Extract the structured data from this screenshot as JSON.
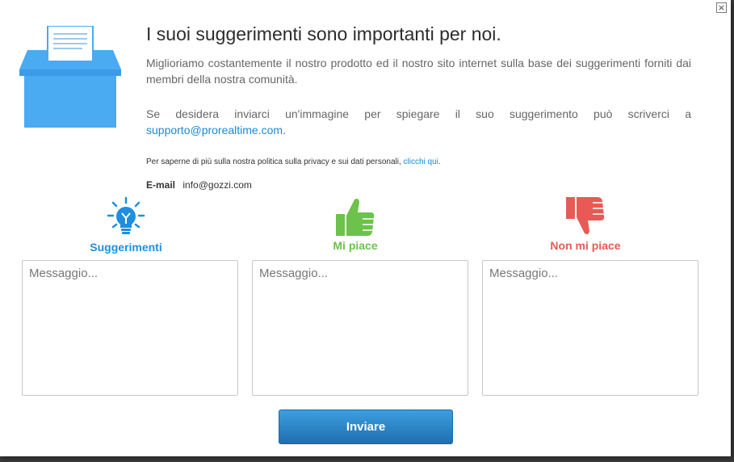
{
  "dialog": {
    "title": "I suoi suggerimenti sono importanti per noi.",
    "close_symbol": "×",
    "intro": "Miglioriamo costantemente il nostro prodotto ed il nostro sito internet sulla base dei suggerimenti forniti dai membri della nostra comunità.",
    "image_note": {
      "text": "Se desidera inviarci un'immagine per spiegare il suo suggerimento può scriverci a",
      "link": "supporto@prorealtime.com",
      "after": "."
    },
    "privacy": {
      "text": "Per saperne di più sulla nostra politica sulla privacy e sui dati personali,",
      "link": "clicchi qui",
      "after": "."
    },
    "email": {
      "label": "E-mail",
      "value": "info@gozzi.com"
    }
  },
  "icons": {
    "ballot": "ballot-box-icon",
    "suggestion": "lightbulb-icon",
    "like": "thumbs-up-icon",
    "dislike": "thumbs-down-icon"
  },
  "categories": [
    {
      "label": "Suggerimenti",
      "color": "#1e8fe0",
      "placeholder": "Messaggio..."
    },
    {
      "label": "Mi piace",
      "color": "#6cc24a",
      "placeholder": "Messaggio..."
    },
    {
      "label": "Non mi piace",
      "color": "#e85a55",
      "placeholder": "Messaggio..."
    }
  ],
  "submit_label": "Inviare",
  "colors": {
    "accent": "#4aaaf2",
    "button": "#2a82c8"
  }
}
